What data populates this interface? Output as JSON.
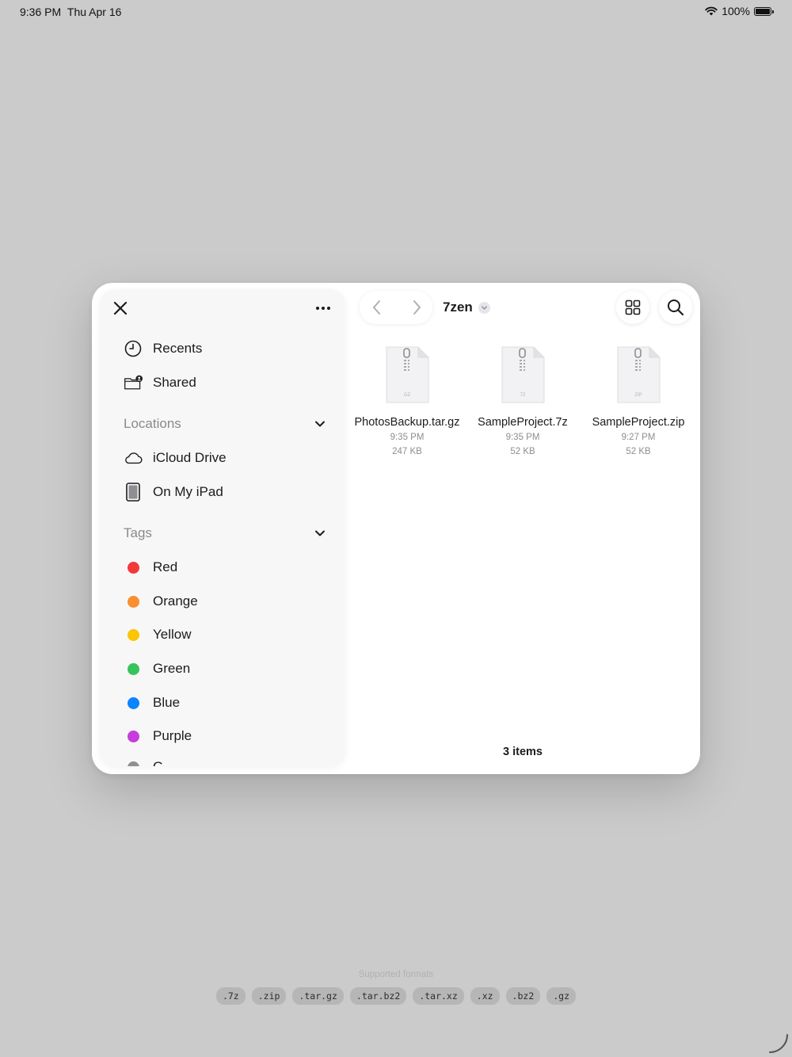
{
  "status_bar": {
    "time": "9:36 PM",
    "date": "Thu Apr 16",
    "battery": "100%"
  },
  "sidebar": {
    "favorites": [
      {
        "label": "Recents",
        "icon": "clock-icon"
      },
      {
        "label": "Shared",
        "icon": "shared-folder-icon"
      }
    ],
    "locations_header": "Locations",
    "locations": [
      {
        "label": "iCloud Drive",
        "icon": "cloud-icon"
      },
      {
        "label": "On My iPad",
        "icon": "ipad-icon"
      }
    ],
    "tags_header": "Tags",
    "tags": [
      {
        "label": "Red",
        "color": "#f2393a"
      },
      {
        "label": "Orange",
        "color": "#f98f2e"
      },
      {
        "label": "Yellow",
        "color": "#fbc500"
      },
      {
        "label": "Green",
        "color": "#36c45a"
      },
      {
        "label": "Blue",
        "color": "#0a84ff"
      },
      {
        "label": "Purple",
        "color": "#c63dde"
      },
      {
        "label": "G",
        "color": "#8e8e93"
      }
    ]
  },
  "main": {
    "folder_title": "7zen",
    "files": [
      {
        "name": "PhotosBackup.tar.gz",
        "time": "9:35 PM",
        "size": "247 KB",
        "ext": "GZ"
      },
      {
        "name": "SampleProject.7z",
        "time": "9:35 PM",
        "size": "52 KB",
        "ext": "7Z"
      },
      {
        "name": "SampleProject.zip",
        "time": "9:27 PM",
        "size": "52 KB",
        "ext": "ZIP"
      }
    ],
    "items_count": "3 items"
  },
  "formats": {
    "label": "Supported formats",
    "items": [
      ".7z",
      ".zip",
      ".tar.gz",
      ".tar.bz2",
      ".tar.xz",
      ".xz",
      ".bz2",
      ".gz"
    ]
  }
}
